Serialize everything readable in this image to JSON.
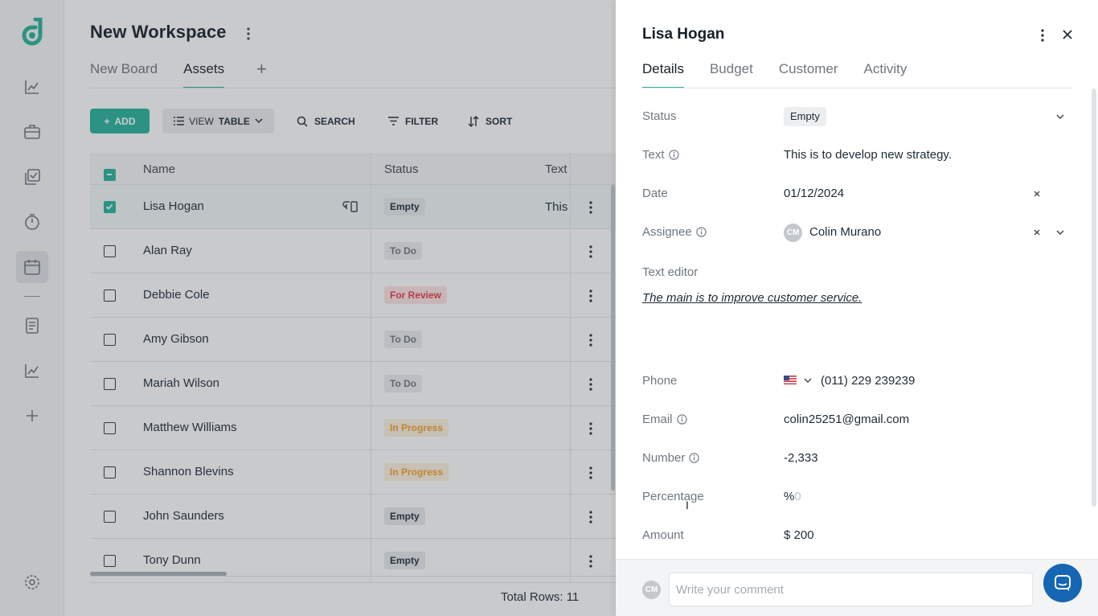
{
  "workspace": {
    "title": "New Workspace",
    "tabs": [
      {
        "label": "New Board"
      },
      {
        "label": "Assets"
      }
    ],
    "add_tab_symbol": "+"
  },
  "toolbar": {
    "add_label": "ADD",
    "view_label": "VIEW",
    "view_mode": "TABLE",
    "search_label": "SEARCH",
    "filter_label": "FILTER",
    "sort_label": "SORT"
  },
  "table": {
    "headers": {
      "name": "Name",
      "status": "Status",
      "text": "Text"
    },
    "rows": [
      {
        "name": "Lisa Hogan",
        "status": "Empty",
        "text": "This",
        "checked": true
      },
      {
        "name": "Alan Ray",
        "status": "To Do",
        "text": "",
        "checked": false
      },
      {
        "name": "Debbie Cole",
        "status": "For Review",
        "text": "",
        "checked": false
      },
      {
        "name": "Amy Gibson",
        "status": "To Do",
        "text": "",
        "checked": false
      },
      {
        "name": "Mariah Wilson",
        "status": "To Do",
        "text": "",
        "checked": false
      },
      {
        "name": "Matthew Williams",
        "status": "In Progress",
        "text": "",
        "checked": false
      },
      {
        "name": "Shannon Blevins",
        "status": "In Progress",
        "text": "",
        "checked": false
      },
      {
        "name": "John Saunders",
        "status": "Empty",
        "text": "",
        "checked": false
      },
      {
        "name": "Tony Dunn",
        "status": "Empty",
        "text": "",
        "checked": false
      }
    ],
    "total_rows_label": "Total Rows: 11"
  },
  "drawer": {
    "title": "Lisa Hogan",
    "tabs": [
      {
        "label": "Details"
      },
      {
        "label": "Budget"
      },
      {
        "label": "Customer"
      },
      {
        "label": "Activity"
      }
    ],
    "fields": {
      "status": {
        "label": "Status",
        "value": "Empty"
      },
      "text": {
        "label": "Text",
        "value": "This is to develop new strategy."
      },
      "date": {
        "label": "Date",
        "value": "01/12/2024"
      },
      "assignee": {
        "label": "Assignee",
        "value": "Colin Murano",
        "initials": "CM"
      },
      "text_editor": {
        "label": "Text editor",
        "value": "The main is to improve customer service."
      },
      "phone": {
        "label": "Phone",
        "value": "(011) 229 239239"
      },
      "email": {
        "label": "Email",
        "value": "colin25251@gmail.com"
      },
      "number": {
        "label": "Number",
        "value": "-2,333"
      },
      "percentage": {
        "label": "Percentage",
        "symbol": "%",
        "placeholder": "0"
      },
      "amount": {
        "label": "Amount",
        "value": "$ 200"
      }
    },
    "comment": {
      "initials": "CM",
      "placeholder": "Write your comment"
    }
  },
  "colors": {
    "accent": "#26b39b",
    "status_review": "#e3384b",
    "status_progress": "#f0a028",
    "chat_button": "#1566b3"
  }
}
